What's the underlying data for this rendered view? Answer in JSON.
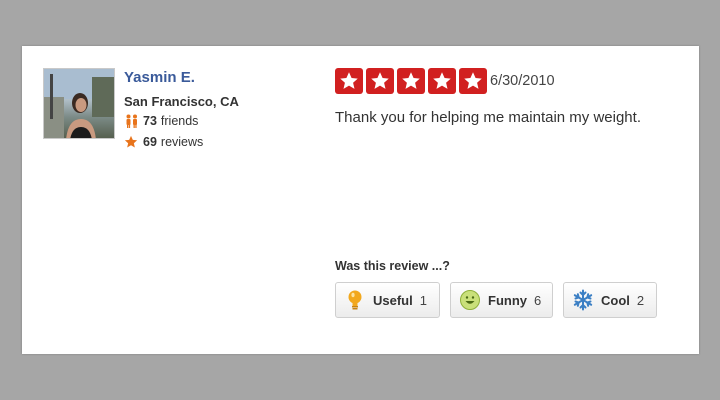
{
  "reviewer": {
    "name": "Yasmin E.",
    "location": "San Francisco, CA",
    "friends_count": "73",
    "friends_label": "friends",
    "reviews_count": "69",
    "reviews_label": "reviews"
  },
  "review": {
    "rating": 5,
    "max_rating": 5,
    "date": "6/30/2010",
    "text": "Thank you for helping me maintain my weight."
  },
  "feedback": {
    "prompt": "Was this review ...?",
    "buttons": [
      {
        "label": "Useful",
        "count": "1",
        "icon": "lightbulb-icon"
      },
      {
        "label": "Funny",
        "count": "6",
        "icon": "smiley-icon"
      },
      {
        "label": "Cool",
        "count": "2",
        "icon": "snowflake-icon"
      }
    ]
  },
  "colors": {
    "star_red": "#d12020",
    "name_blue": "#3a5a9a",
    "friends_orange": "#e8741c"
  }
}
